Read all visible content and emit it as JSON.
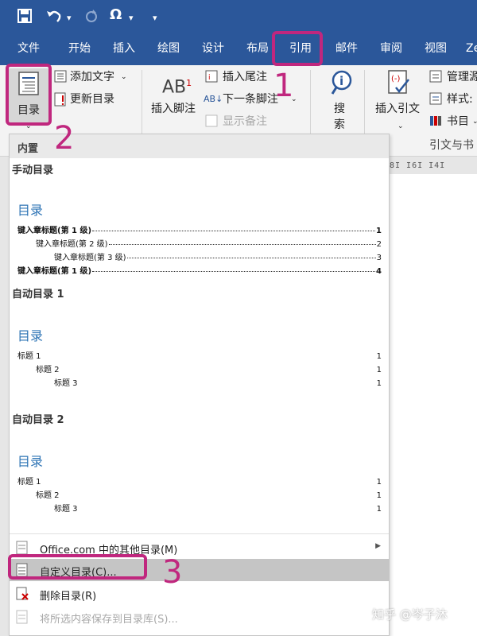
{
  "qat": {
    "symbol_label": "Ω"
  },
  "tabs": [
    "文件",
    "开始",
    "插入",
    "绘图",
    "设计",
    "布局",
    "引用",
    "邮件",
    "审阅",
    "视图",
    "Ze"
  ],
  "ribbon": {
    "toc_button": "目录",
    "add_text": "添加文字",
    "update_toc": "更新目录",
    "insert_footnote": "插入脚注",
    "insert_endnote": "插入尾注",
    "next_footnote": "下一条脚注",
    "show_notes": "显示备注",
    "search_line1": "搜",
    "search_line2": "索",
    "insert_citation": "插入引文",
    "manage_sources": "管理源",
    "style": "样式:",
    "bibliography": "书目",
    "citations_group": "引文与书"
  },
  "ruler": "8I  I6I  I4I",
  "gallery": {
    "header": "内置",
    "manual": {
      "title": "手动目录",
      "heading": "目录",
      "rows": [
        {
          "label": "键入章标题(第 1 级)",
          "page": "1"
        },
        {
          "label": "键入章标题(第 2 级)",
          "page": "2"
        },
        {
          "label": "键入章标题(第 3 级)",
          "page": "3"
        },
        {
          "label": "键入章标题(第 1 级)",
          "page": "4"
        }
      ]
    },
    "auto1": {
      "title": "自动目录 1",
      "heading": "目录",
      "rows": [
        {
          "label": "标题 1",
          "page": "1"
        },
        {
          "label": "标题 2",
          "page": "1"
        },
        {
          "label": "标题 3",
          "page": "1"
        }
      ]
    },
    "auto2": {
      "title": "自动目录 2",
      "heading": "目录",
      "rows": [
        {
          "label": "标题 1",
          "page": "1"
        },
        {
          "label": "标题 2",
          "page": "1"
        },
        {
          "label": "标题 3",
          "page": "1"
        }
      ]
    },
    "menu": {
      "more_online": "Office.com 中的其他目录(M)",
      "custom_toc": "自定义目录(C)...",
      "remove_toc": "删除目录(R)",
      "save_selection": "将所选内容保存到目录库(S)..."
    }
  },
  "annotations": [
    "1",
    "2",
    "3"
  ],
  "watermark": "知乎 @岑子沐",
  "colors": {
    "ribbon_blue": "#2b579a",
    "annotation": "#c0277e",
    "toc_heading": "#2e74b5"
  }
}
